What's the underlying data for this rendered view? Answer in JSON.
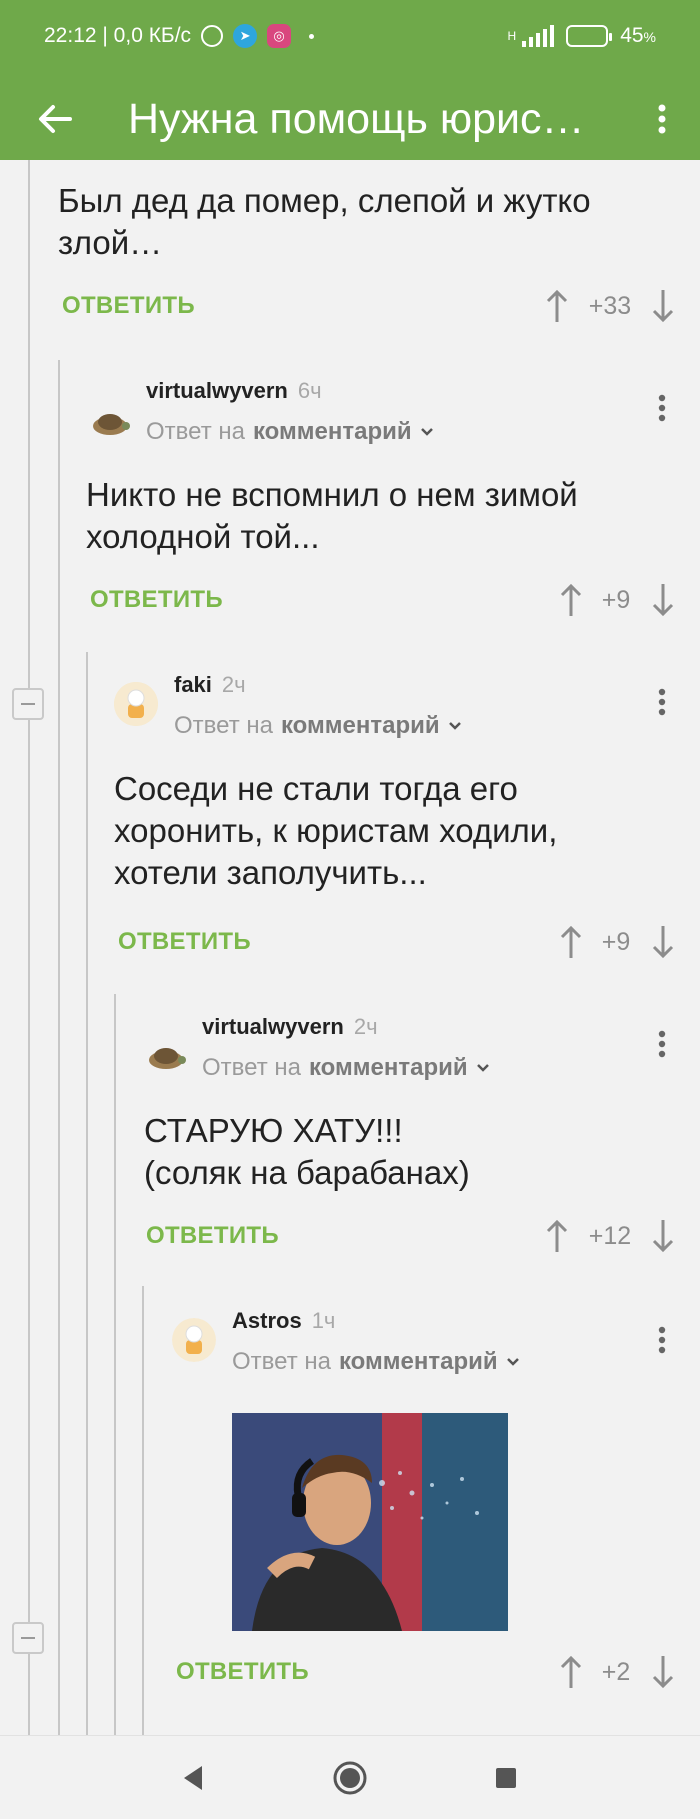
{
  "status": {
    "time_speed": "22:12 | 0,0 КБ/с",
    "network": "H",
    "battery": "45",
    "battery_unit": "%",
    "battery_level": 0.45
  },
  "toolbar": {
    "title": "Нужна помощь юрис…"
  },
  "colors": {
    "accent": "#6fa94a",
    "reply_link": "#7cb84b"
  },
  "comments": [
    {
      "text": "Был дед да помер, слепой и жутко злой…",
      "reply_label": "ОТВЕТИТЬ",
      "score": "+33"
    },
    {
      "user": "virtualwyvern",
      "time": "6ч",
      "reply_prefix": "Ответ на",
      "reply_target": "комментарий",
      "text": "Никто не вспомнил о нем зимой холодной той...",
      "reply_label": "ОТВЕТИТЬ",
      "score": "+9"
    },
    {
      "user": "faki",
      "time": "2ч",
      "reply_prefix": "Ответ на",
      "reply_target": "комментарий",
      "text_lines": [
        "Соседи не стали тогда его",
        "хоронить, к юристам ходили,",
        "хотели заполучить..."
      ],
      "reply_label": "ОТВЕТИТЬ",
      "score": "+9"
    },
    {
      "user": "virtualwyvern",
      "time": "2ч",
      "reply_prefix": "Ответ на",
      "reply_target": "комментарий",
      "text_lines": [
        "СТАРУЮ ХАТУ!!!",
        "(соляк на барабанах)"
      ],
      "reply_label": "ОТВЕТИТЬ",
      "score": "+12"
    },
    {
      "user": "Astros",
      "time": "1ч",
      "reply_prefix": "Ответ на",
      "reply_target": "комментарий",
      "reply_label": "ОТВЕТИТЬ",
      "score": "+2"
    }
  ]
}
